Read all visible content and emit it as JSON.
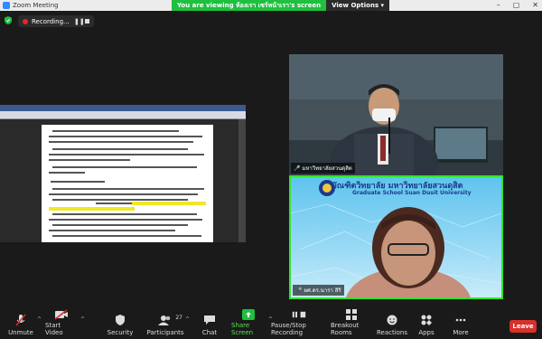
{
  "window": {
    "title": "Zoom Meeting",
    "controls": [
      "minimize-icon",
      "maximize-icon",
      "close-icon"
    ]
  },
  "banner": {
    "viewing_text": "You are viewing ห้องเรา เซร์หน้าเรา's screen",
    "view_options_label": "View Options"
  },
  "recording": {
    "label": "Recording..."
  },
  "tiles": {
    "presenter_name": "มหาวิทยาลัยสวนดุสิต",
    "participant_name": "ผศ.ดร.นารา สิริ",
    "participant_banner": "บัณฑิตวิทยาลัย มหาวิทยาลัยสวนดุสิต",
    "participant_banner_en": "Graduate School Suan Dusit University"
  },
  "toolbar": {
    "unmute": "Unmute",
    "start_video": "Start Video",
    "security": "Security",
    "participants": "Participants",
    "participants_count": "27",
    "chat": "Chat",
    "share_screen": "Share Screen",
    "pause_stop_recording": "Pause/Stop Recording",
    "breakout_rooms": "Breakout Rooms",
    "reactions": "Reactions",
    "apps": "Apps",
    "more": "More",
    "leave": "Leave"
  },
  "colors": {
    "accent_green": "#1fbf3f",
    "leave_red": "#d7312b",
    "record_red": "#e02828"
  }
}
